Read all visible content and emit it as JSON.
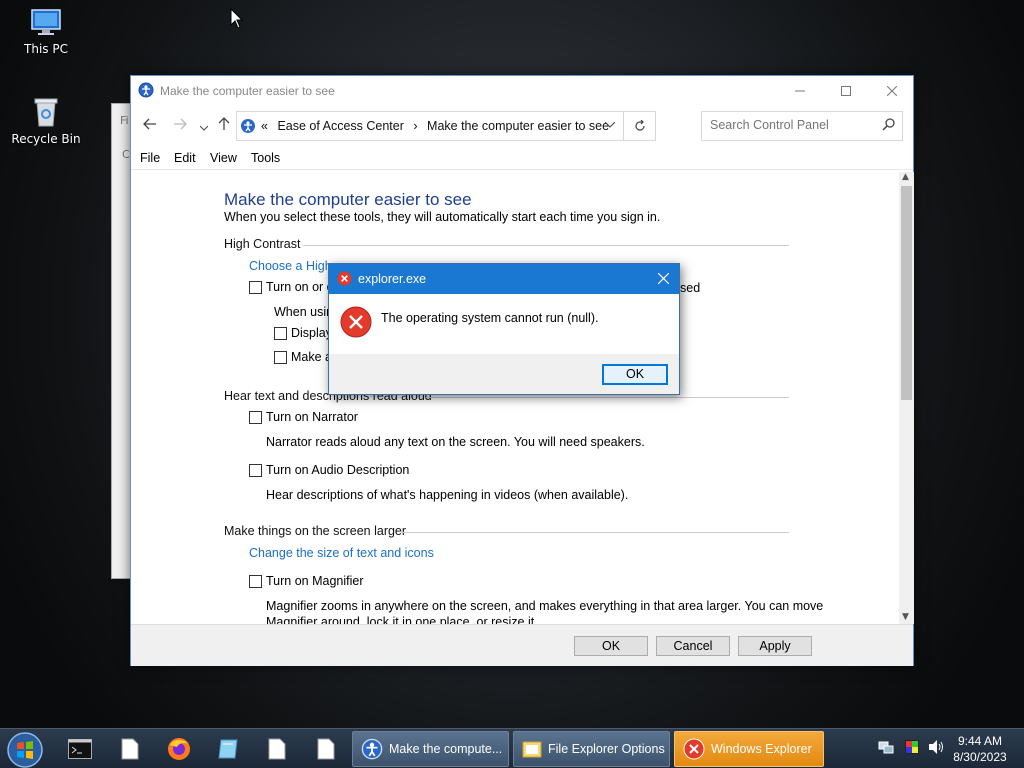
{
  "desktop": {
    "icons": [
      {
        "label": "This PC"
      },
      {
        "label": "Recycle Bin"
      }
    ]
  },
  "back_window": {
    "fragment1": "Fi",
    "fragment2": "C"
  },
  "cp_window": {
    "title": "Make the computer easier to see",
    "address": {
      "chevrons": "«",
      "crumb1": "Ease of Access Center",
      "sep": "›",
      "crumb2": "Make the computer easier to see"
    },
    "search_placeholder": "Search Control Panel",
    "menu": [
      "File",
      "Edit",
      "View",
      "Tools"
    ],
    "heading": "Make the computer easier to see",
    "subtitle": "When you select these tools, they will automatically start each time you sign in.",
    "sections": {
      "high_contrast": {
        "title": "High Contrast",
        "link": "Choose a High",
        "cb1": "Turn on or o",
        "cb1_tail": "sed",
        "when_text": "When usin",
        "cb2": "Display",
        "cb3": "Make a"
      },
      "narrator": {
        "title": "Hear text and descriptions read aloud",
        "cb_narrator": "Turn on Narrator",
        "narrator_desc": "Narrator reads aloud any text on the screen. You will need speakers.",
        "cb_audio": "Turn on Audio Description",
        "audio_desc": "Hear descriptions of what's happening in videos (when available)."
      },
      "larger": {
        "title": "Make things on the screen larger",
        "link": "Change the size of text and icons",
        "cb_magnifier": "Turn on Magnifier",
        "magnifier_desc_1": "Magnifier zooms in anywhere on the screen, and makes everything in that area larger. You can move",
        "magnifier_desc_2": "Magnifier around, lock it in one place, or resize it."
      }
    },
    "buttons": {
      "ok": "OK",
      "cancel": "Cancel",
      "apply": "Apply"
    }
  },
  "error_dialog": {
    "title": "explorer.exe",
    "message": "The operating system cannot run (null).",
    "ok": "OK"
  },
  "taskbar": {
    "tasks": [
      {
        "label": "Make the compute..."
      },
      {
        "label": "File Explorer Options"
      },
      {
        "label": "Windows Explorer"
      }
    ],
    "clock": {
      "time": "9:44 AM",
      "date": "8/30/2023"
    }
  },
  "colors": {
    "heading": "#1e3f8f",
    "link": "#1a6fc8",
    "error_title": "#1a78d2",
    "alert_task": "#e28a12"
  }
}
